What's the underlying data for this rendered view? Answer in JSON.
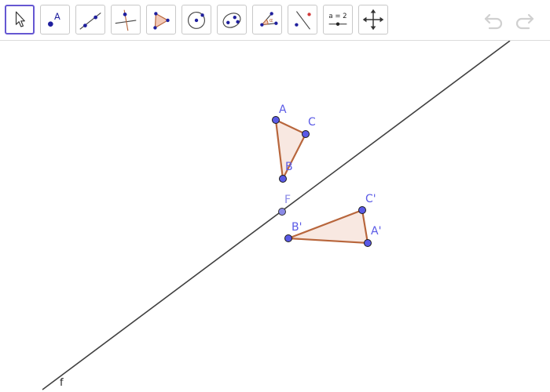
{
  "toolbar": {
    "tools": [
      {
        "name": "move-tool",
        "icon": "cursor-arrow-icon"
      },
      {
        "name": "point-tool",
        "icon": "point-icon",
        "label": "A"
      },
      {
        "name": "line-tool",
        "icon": "line-through-points-icon"
      },
      {
        "name": "perpendicular-line-tool",
        "icon": "perpendicular-line-icon"
      },
      {
        "name": "polygon-tool",
        "icon": "polygon-icon"
      },
      {
        "name": "circle-tool",
        "icon": "circle-center-point-icon"
      },
      {
        "name": "ellipse-tool",
        "icon": "ellipse-icon"
      },
      {
        "name": "angle-tool",
        "icon": "angle-icon"
      },
      {
        "name": "reflect-tool",
        "icon": "reflect-about-line-icon"
      },
      {
        "name": "slider-tool",
        "icon": "slider-icon",
        "label": "a = 2"
      },
      {
        "name": "move-graphics-view-tool",
        "icon": "move-arrows-icon"
      }
    ],
    "undo_icon": "undo-icon",
    "redo_icon": "redo-icon"
  },
  "colors": {
    "accent": "#6557d2",
    "point_fill": "#5a5ae6",
    "label": "#5a5ae6",
    "polygon_stroke": "#b8663c",
    "polygon_fill": "#f7e6de",
    "line": "#404040",
    "history_icon": "#d0d0d0"
  },
  "canvas": {
    "line_label": "f",
    "points": {
      "A": "A",
      "B": "B",
      "C": "C",
      "F": "F",
      "A_prime": "A'",
      "B_prime": "B'",
      "C_prime": "C'"
    }
  }
}
